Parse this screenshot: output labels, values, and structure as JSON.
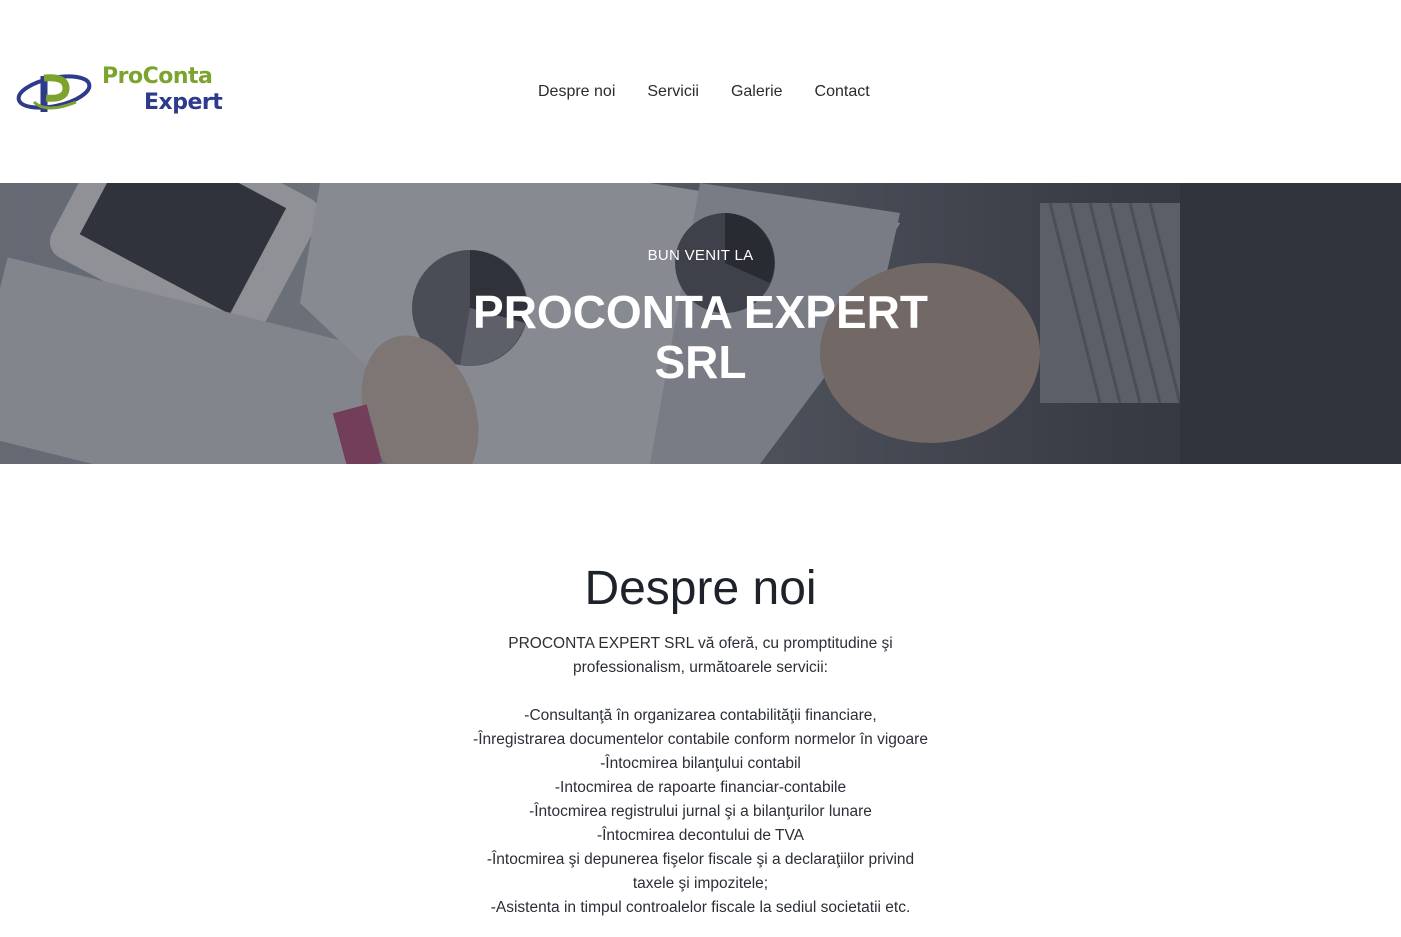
{
  "logo": {
    "line1": "ProConta",
    "line2": "Expert"
  },
  "nav": {
    "items": [
      {
        "label": "Despre noi"
      },
      {
        "label": "Servicii"
      },
      {
        "label": "Galerie"
      },
      {
        "label": "Contact"
      }
    ]
  },
  "hero": {
    "kicker": "BUN VENIT LA",
    "title": "PROCONTA EXPERT SRL"
  },
  "about": {
    "title": "Despre noi",
    "intro": "PROCONTA EXPERT SRL vă oferă, cu promptitudine şi professionalism, următoarele servicii:",
    "services": [
      "-Consultanţă în organizarea contabilităţii financiare,",
      "-Înregistrarea documentelor contabile conform normelor în vigoare",
      "-Întocmirea bilanţului contabil",
      "-Intocmirea de rapoarte financiar-contabile",
      "-Întocmirea registrului jurnal şi a bilanţurilor lunare",
      "-Întocmirea decontului de TVA",
      "-Întocmirea şi depunerea fişelor fiscale şi a declaraţiilor privind taxele şi impozitele;",
      "-Asistenta in timpul controalelor fiscale la sediul societatii etc."
    ]
  },
  "colors": {
    "logo_green": "#7ba32d",
    "logo_blue": "#2e3a8c",
    "text_dark": "#1e222b"
  }
}
